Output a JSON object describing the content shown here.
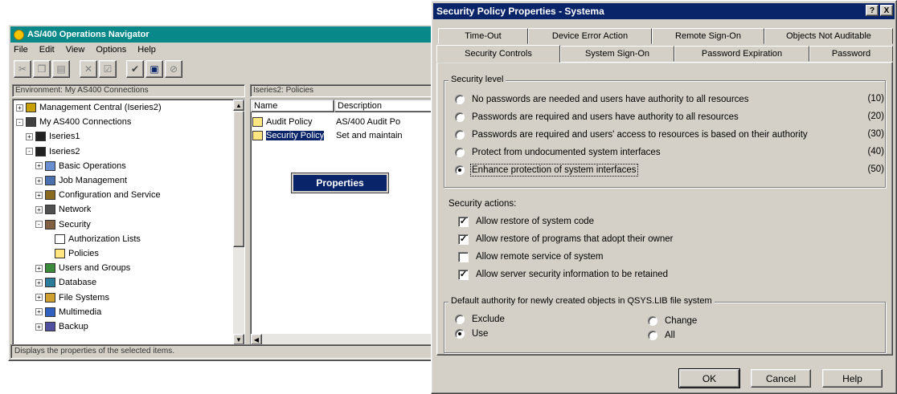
{
  "navigator": {
    "title": "AS/400 Operations Navigator",
    "menu": [
      "File",
      "Edit",
      "View",
      "Options",
      "Help"
    ],
    "env_label": "Environment: My AS400 Connections",
    "list_header": "Iseries2:  Policies",
    "status": "Displays the properties of the selected items.",
    "tree": [
      {
        "label": "Management Central (Iseries2)",
        "expand": "+",
        "depth": 0,
        "icon": "management-central-icon"
      },
      {
        "label": "My AS400 Connections",
        "expand": "-",
        "depth": 0,
        "icon": "connections-icon"
      },
      {
        "label": "Iseries1",
        "expand": "+",
        "depth": 1,
        "icon": "server-icon"
      },
      {
        "label": "Iseries2",
        "expand": "-",
        "depth": 1,
        "icon": "server-icon"
      },
      {
        "label": "Basic Operations",
        "expand": "+",
        "depth": 2,
        "icon": "basic-operations-icon"
      },
      {
        "label": "Job Management",
        "expand": "+",
        "depth": 2,
        "icon": "job-management-icon"
      },
      {
        "label": "Configuration and Service",
        "expand": "+",
        "depth": 2,
        "icon": "configuration-icon"
      },
      {
        "label": "Network",
        "expand": "+",
        "depth": 2,
        "icon": "network-icon"
      },
      {
        "label": "Security",
        "expand": "-",
        "depth": 2,
        "icon": "security-icon"
      },
      {
        "label": "Authorization Lists",
        "expand": "",
        "depth": 3,
        "icon": "authorization-list-icon"
      },
      {
        "label": "Policies",
        "expand": "",
        "depth": 3,
        "icon": "policies-icon"
      },
      {
        "label": "Users and Groups",
        "expand": "+",
        "depth": 2,
        "icon": "users-groups-icon"
      },
      {
        "label": "Database",
        "expand": "+",
        "depth": 2,
        "icon": "database-icon"
      },
      {
        "label": "File Systems",
        "expand": "+",
        "depth": 2,
        "icon": "file-systems-icon"
      },
      {
        "label": "Multimedia",
        "expand": "+",
        "depth": 2,
        "icon": "multimedia-icon"
      },
      {
        "label": "Backup",
        "expand": "+",
        "depth": 2,
        "icon": "backup-icon"
      }
    ],
    "list_columns": [
      "Name",
      "Description"
    ],
    "list_rows": [
      {
        "name": "Audit Policy",
        "description": "AS/400 Audit Po"
      },
      {
        "name": "Security Policy",
        "description": "Set and maintain"
      }
    ],
    "context_menu": "Properties"
  },
  "dialog": {
    "title": "Security Policy Properties - Systema",
    "tabs_back": [
      "Time-Out",
      "Device Error Action",
      "Remote Sign-On",
      "Objects Not Auditable"
    ],
    "tabs_front": [
      "Security Controls",
      "System Sign-On",
      "Password Expiration",
      "Password"
    ],
    "security_level_label": "Security level",
    "security_levels": [
      {
        "label": "No passwords are needed and users have authority to all resources",
        "value": "(10)",
        "selected": false
      },
      {
        "label": "Passwords are required and users have authority to all resources",
        "value": "(20)",
        "selected": false
      },
      {
        "label": "Passwords are required and users' access to resources is based on their authority",
        "value": "(30)",
        "selected": false
      },
      {
        "label": "Protect from undocumented system interfaces",
        "value": "(40)",
        "selected": false
      },
      {
        "label": "Enhance protection of system interfaces",
        "value": "(50)",
        "selected": true
      }
    ],
    "security_actions_label": "Security actions:",
    "security_actions": [
      {
        "label": "Allow restore of system code",
        "checked": true
      },
      {
        "label": "Allow restore of programs that adopt their owner",
        "checked": true
      },
      {
        "label": "Allow remote service of system",
        "checked": false
      },
      {
        "label": "Allow server security information to be retained",
        "checked": true
      }
    ],
    "default_authority_label": "Default authority for newly created objects in QSYS.LIB file system",
    "default_authority": [
      {
        "label": "Exclude",
        "selected": false
      },
      {
        "label": "Change",
        "selected": false
      },
      {
        "label": "Use",
        "selected": true
      },
      {
        "label": "All",
        "selected": false
      }
    ],
    "buttons": {
      "ok": "OK",
      "cancel": "Cancel",
      "help": "Help"
    },
    "title_buttons": {
      "help": "?",
      "close": "X"
    }
  }
}
